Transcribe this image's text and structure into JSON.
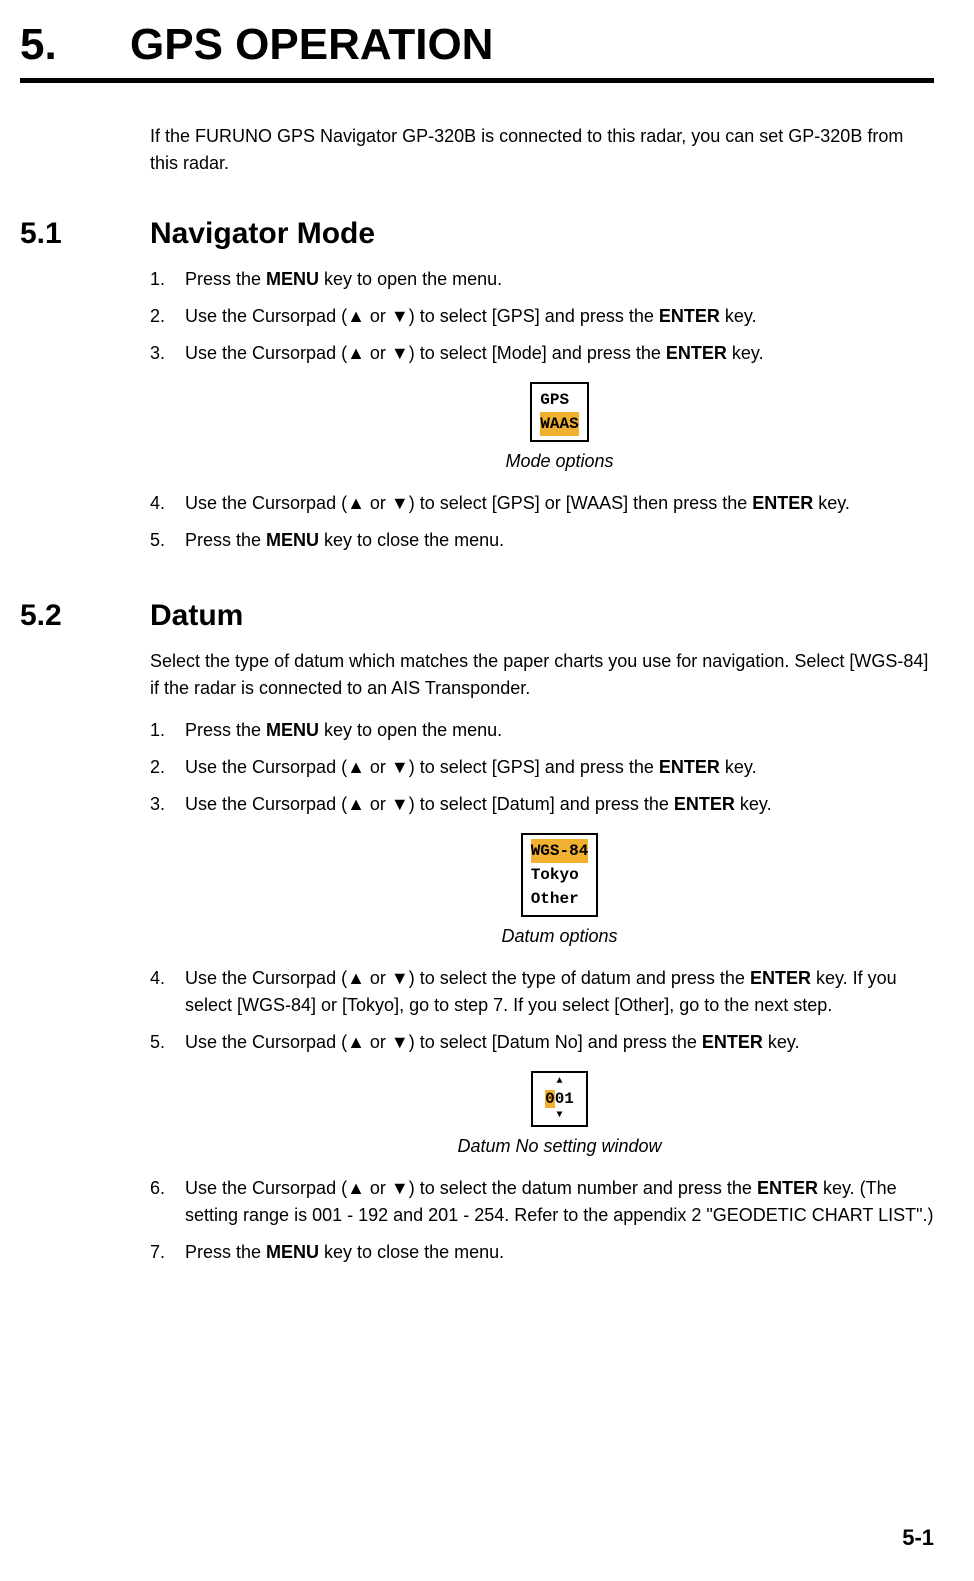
{
  "chapter": {
    "number": "5.",
    "title": "GPS OPERATION"
  },
  "intro": "If the FURUNO GPS Navigator GP-320B is connected to this radar, you can set GP-320B from this radar.",
  "section51": {
    "number": "5.1",
    "title": "Navigator Mode",
    "step1_a": "Press the ",
    "step1_b": " key to open the menu.",
    "step1_key": "MENU",
    "step2_a": "Use the Cursorpad (",
    "step2_b": " or ",
    "step2_c": ") to select [GPS] and press the ",
    "step2_d": " key.",
    "step2_key": "ENTER",
    "step3_a": "Use the Cursorpad (",
    "step3_b": " or ",
    "step3_c": ") to select [Mode] and press the ",
    "step3_d": " key.",
    "step3_key": "ENTER",
    "figure_line1": "GPS",
    "figure_line2": "WAAS",
    "figure_caption": "Mode options",
    "step4_a": "Use the Cursorpad (",
    "step4_b": " or ",
    "step4_c": ") to select [GPS] or [WAAS] then press the ",
    "step4_d": " key.",
    "step4_key": "ENTER",
    "step5_a": "Press the ",
    "step5_b": " key to close the menu.",
    "step5_key": "MENU"
  },
  "section52": {
    "number": "5.2",
    "title": "Datum",
    "intro": "Select the type of datum which matches the paper charts you use for navigation. Select [WGS-84] if the radar is connected to an AIS Transponder.",
    "step1_a": "Press the ",
    "step1_b": " key to open the menu.",
    "step1_key": "MENU",
    "step2_a": "Use the Cursorpad (",
    "step2_b": " or ",
    "step2_c": ") to select [GPS] and press the ",
    "step2_d": " key.",
    "step2_key": "ENTER",
    "step3_a": "Use the Cursorpad (",
    "step3_b": " or ",
    "step3_c": ") to select [Datum] and press the ",
    "step3_d": " key.",
    "step3_key": "ENTER",
    "figure1_line1": "WGS-84",
    "figure1_line2": "Tokyo",
    "figure1_line3": "Other",
    "figure1_caption": "Datum options",
    "step4_a": "Use the Cursorpad (",
    "step4_b": " or ",
    "step4_c": ") to select the type of datum and press the ",
    "step4_d": " key. If you select [WGS-84] or [Tokyo], go to step 7. If you select [Other], go to the next step.",
    "step4_key": "ENTER",
    "step5_a": "Use the Cursorpad (",
    "step5_b": " or ",
    "step5_c": ") to select [Datum No] and press the ",
    "step5_d": " key.",
    "step5_key": "ENTER",
    "figure2_first": "0",
    "figure2_rest": "01",
    "figure2_caption": "Datum No setting window",
    "step6_a": "Use the Cursorpad (",
    "step6_b": " or ",
    "step6_c": ") to select the datum number and press the ",
    "step6_d": " key. (The setting range is 001 - 192 and 201 - 254. Refer to the appendix 2 \"GEODETIC CHART LIST\".)",
    "step6_key": "ENTER",
    "step7_a": "Press the ",
    "step7_b": " key to close the menu.",
    "step7_key": "MENU"
  },
  "page_number": "5-1"
}
